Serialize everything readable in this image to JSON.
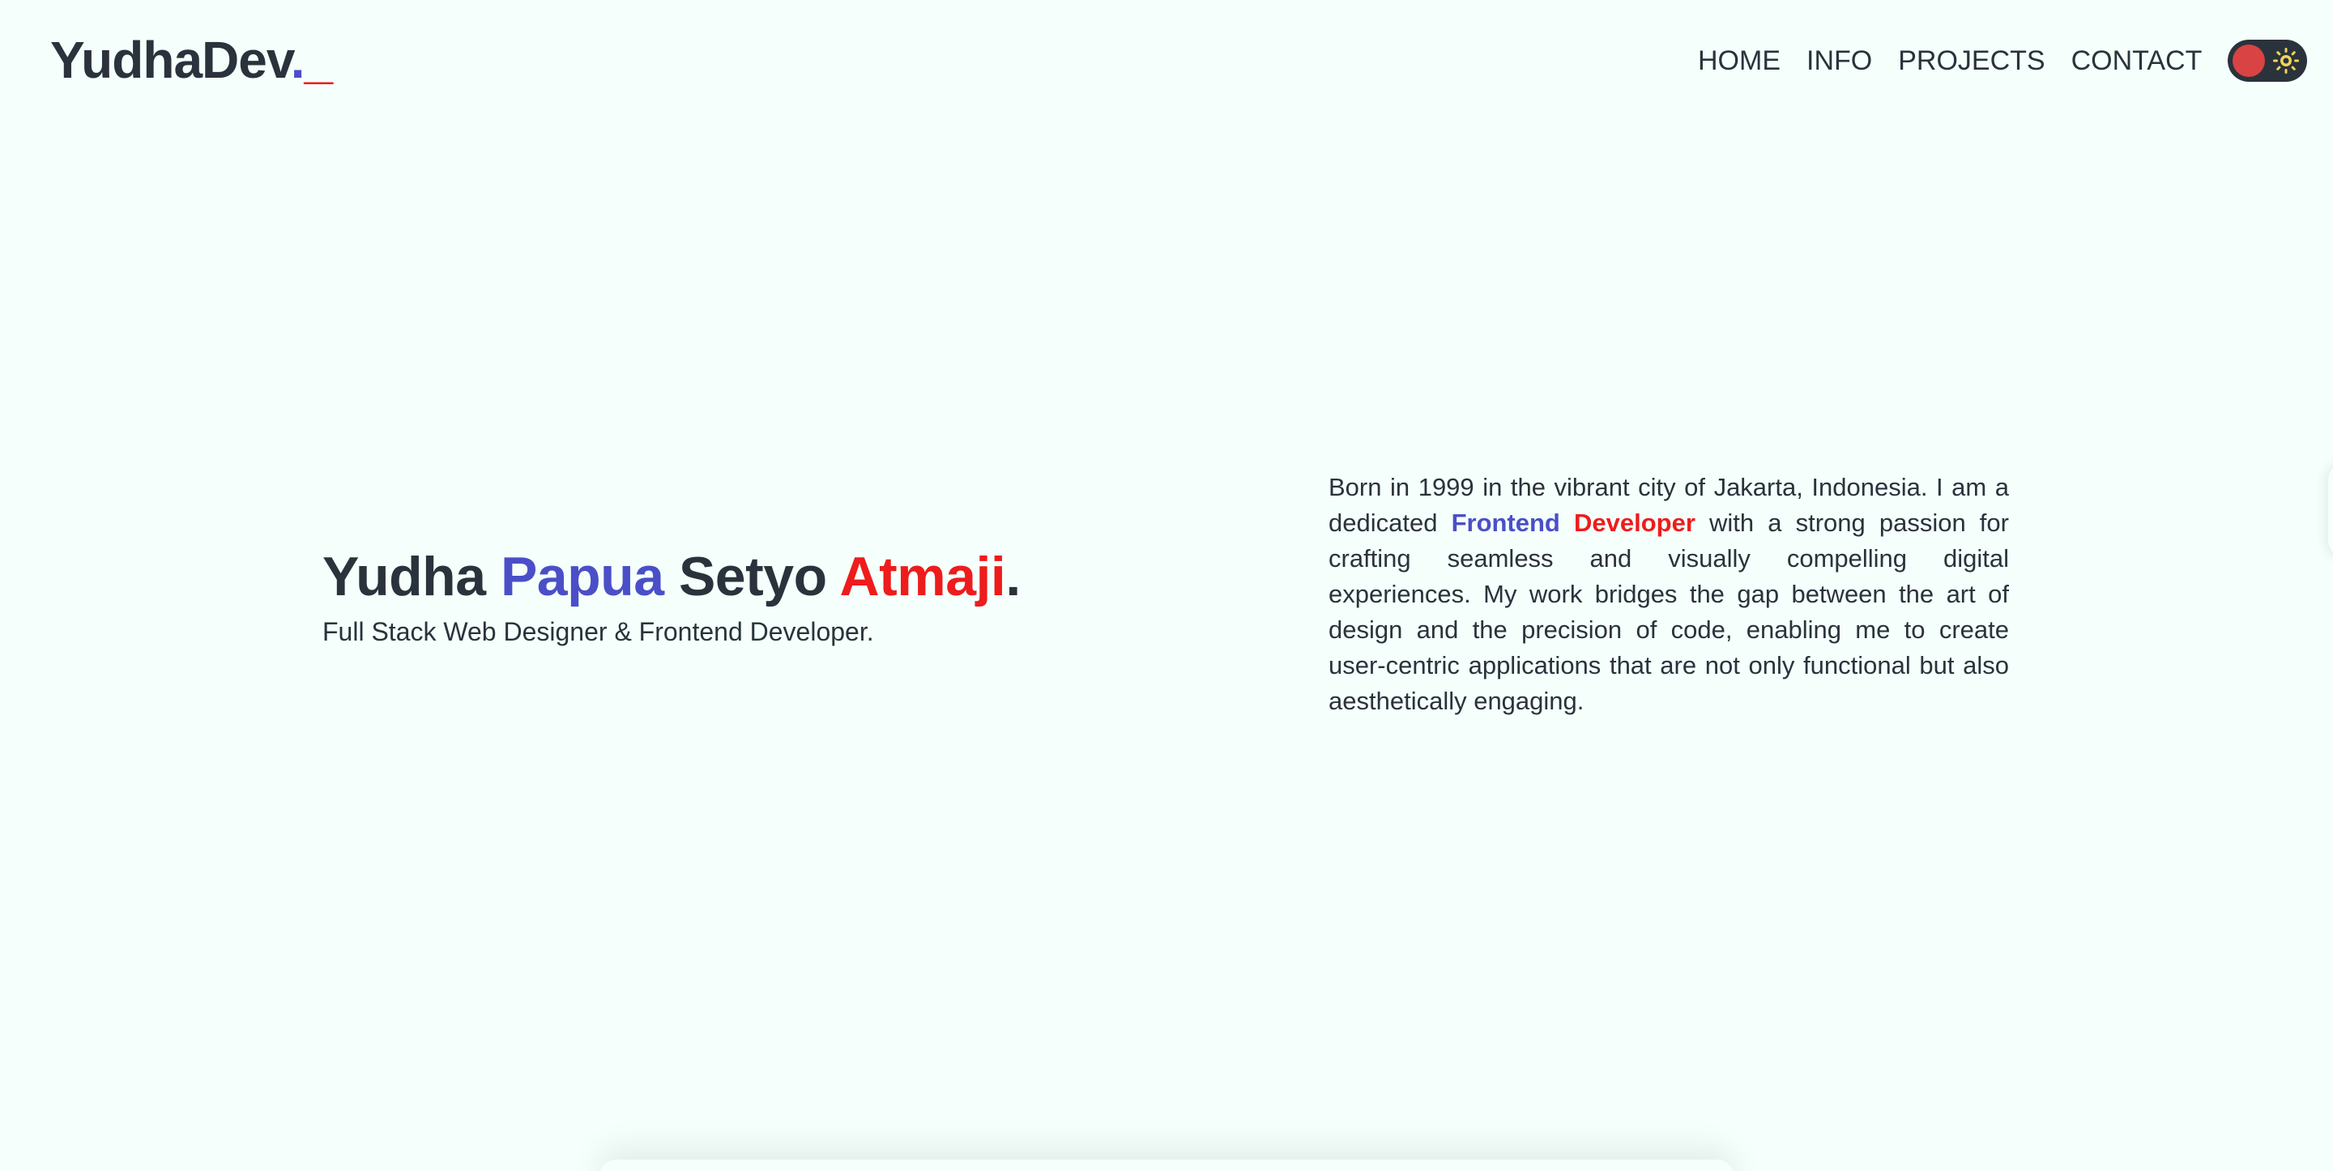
{
  "header": {
    "logo_text": "YudhaDev",
    "logo_dot": ".",
    "logo_underscore": "_",
    "nav": [
      {
        "label": "HOME"
      },
      {
        "label": "INFO"
      },
      {
        "label": "PROJECTS"
      },
      {
        "label": "CONTACT"
      }
    ],
    "theme_toggle": {
      "state": "light",
      "icon": "sun-icon"
    }
  },
  "hero": {
    "name_part1": "Yudha",
    "name_part2": "Papua",
    "name_part3": "Setyo",
    "name_part4": "Atmaji",
    "name_period": ".",
    "subtitle": "Full Stack Web Designer & Frontend Developer."
  },
  "about": {
    "text_before": "Born in 1999 in the vibrant city of Jakarta, Indonesia. I am a dedicated",
    "highlight_blue": "Frontend",
    "highlight_red": "Developer",
    "text_after": "with a strong passion for crafting seamless and visually compelling digital experiences. My work bridges the gap between the art of design and the precision of code, enabling me to create user-centric applications that are not only functional but also aesthetically engaging."
  },
  "colors": {
    "background": "#f5fffb",
    "text": "#2a333c",
    "accent_blue": "#4a4fc8",
    "accent_red": "#ee1c1c",
    "toggle_knob": "#d94343",
    "toggle_sun": "#f3d35a"
  }
}
